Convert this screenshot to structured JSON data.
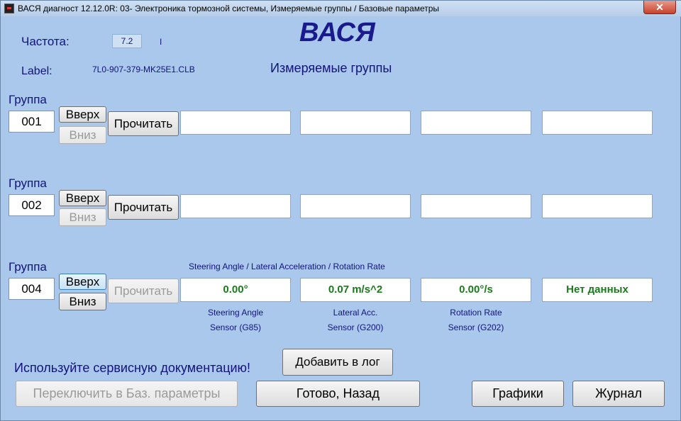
{
  "window": {
    "title": "ВАСЯ диагност 12.12.0R: 03- Электроника тормозной системы,  Измеряемые группы / Базовые параметры",
    "close_label": "✕"
  },
  "header": {
    "freq_label": "Частота:",
    "freq_value": "7.2",
    "freq_tick": "I",
    "app_title": "ВАСЯ",
    "label_label": "Label:",
    "label_value": "7L0-907-379-MK25E1.CLB",
    "subtitle": "Измеряемые группы"
  },
  "groups": [
    {
      "title": "Группа",
      "number": "001",
      "up_label": "Вверх",
      "down_label": "Вниз",
      "read_label": "Прочитать",
      "up_disabled": false,
      "down_disabled": true,
      "read_disabled": false,
      "heading": "",
      "fields": [
        "",
        "",
        "",
        ""
      ],
      "captions": [
        "",
        "",
        "",
        ""
      ]
    },
    {
      "title": "Группа",
      "number": "002",
      "up_label": "Вверх",
      "down_label": "Вниз",
      "read_label": "Прочитать",
      "up_disabled": false,
      "down_disabled": true,
      "read_disabled": false,
      "heading": "",
      "fields": [
        "",
        "",
        "",
        ""
      ],
      "captions": [
        "",
        "",
        "",
        ""
      ]
    },
    {
      "title": "Группа",
      "number": "004",
      "up_label": "Вверх",
      "down_label": "Вниз",
      "read_label": "Прочитать",
      "up_disabled": false,
      "down_disabled": false,
      "read_disabled": true,
      "heading": "Steering Angle / Lateral Acceleration / Rotation Rate",
      "fields": [
        "0.00°",
        "0.07 m/s^2",
        "0.00°/s",
        "Нет данных"
      ],
      "captions": [
        [
          "Steering Angle",
          "Sensor (G85)"
        ],
        [
          "Lateral Acc.",
          "Sensor (G200)"
        ],
        [
          "Rotation Rate",
          "Sensor (G202)"
        ]
      ]
    }
  ],
  "footer": {
    "service_text": "Используйте сервисную документацию!",
    "add_log_label": "Добавить в лог",
    "switch_label": "Переключить в Баз. параметры",
    "back_label": "Готово, Назад",
    "graphs_label": "Графики",
    "journal_label": "Журнал"
  },
  "colors": {
    "background": "#a9c8ec",
    "label_text": "#13137a",
    "value_text": "#1b7a1b"
  }
}
